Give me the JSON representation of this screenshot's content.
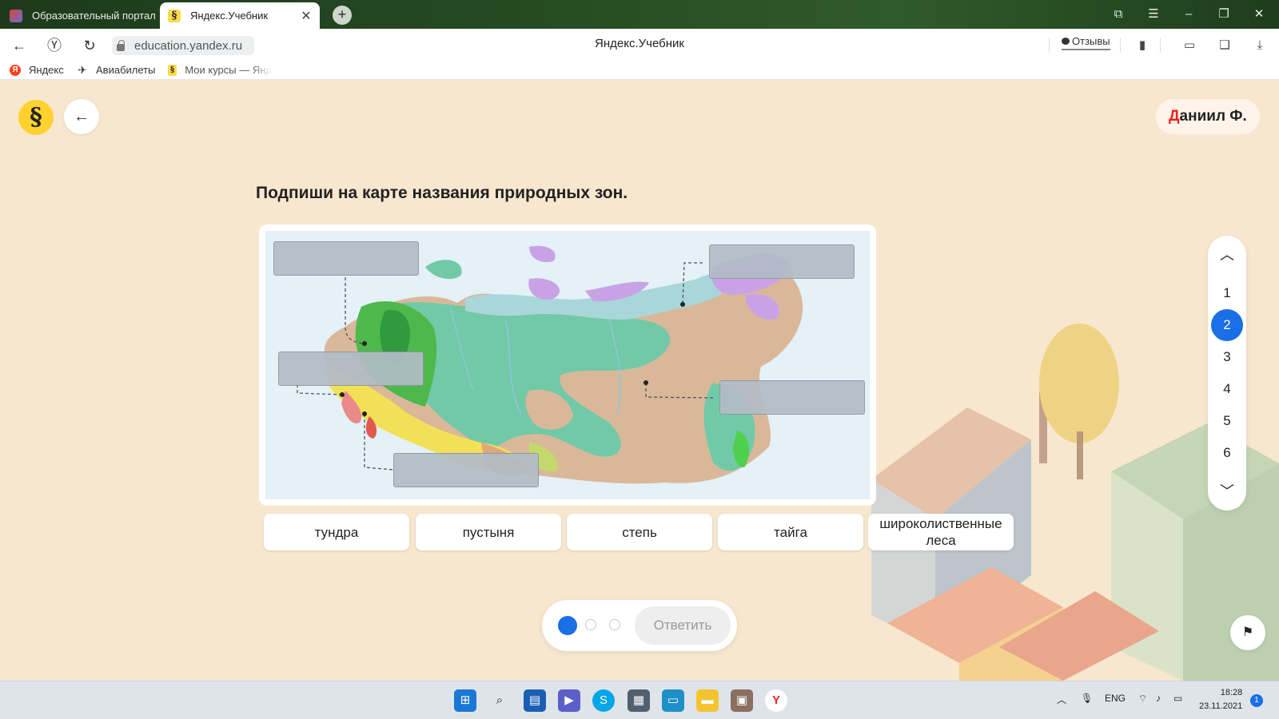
{
  "browser": {
    "tabs": [
      {
        "title": "Образовательный портал",
        "favicon": "portal-icon",
        "active": false
      },
      {
        "title": "Яндекс.Учебник",
        "favicon": "uchebnik-icon",
        "active": true
      }
    ],
    "url": "education.yandex.ru",
    "page_title": "Яндекс.Учебник",
    "feedback_label": "Отзывы",
    "bookmarks": [
      {
        "label": "Яндекс",
        "icon": "yandex-icon"
      },
      {
        "label": "Авиабилеты",
        "icon": "plane-icon"
      },
      {
        "label": "Мои курсы — Янд",
        "icon": "uchebnik-icon"
      }
    ]
  },
  "page": {
    "logo": "§",
    "user": {
      "first_letter": "Д",
      "rest": "аниил Ф."
    },
    "question": "Подпиши на карте названия природных зон.",
    "map": {
      "image": "natural-zones-map-of-russia",
      "slots": 5
    },
    "answers": [
      "тундра",
      "пустыня",
      "степь",
      "тайга",
      "широколиственные леса"
    ],
    "steps": {
      "count": 3,
      "current": 1
    },
    "answer_button": "Ответить",
    "pager": {
      "items": [
        "1",
        "2",
        "3",
        "4",
        "5",
        "6"
      ],
      "current": "2"
    },
    "flag_icon": "flag-icon"
  },
  "taskbar": {
    "lang": "ENG",
    "time": "18:28",
    "date": "23.11.2021",
    "notifications": "1"
  },
  "colors": {
    "accent": "#1a6ee6",
    "page_bg": "#f7e7cf",
    "tundra": "#c9a2e6",
    "taiga": "#72c9a7",
    "mountains": "#d9b89a",
    "steppe": "#f2e157",
    "forest": "#4fb84c"
  }
}
